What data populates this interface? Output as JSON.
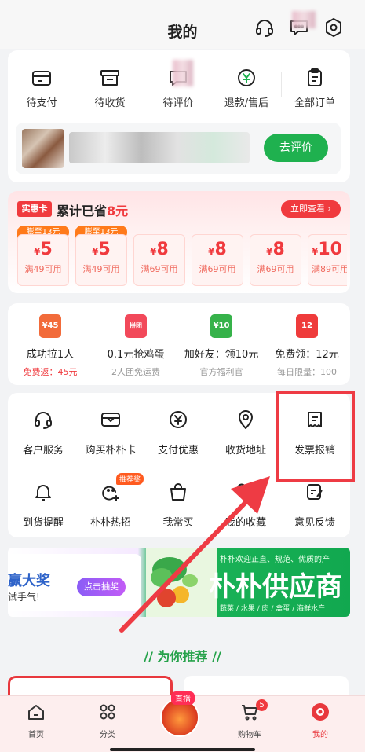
{
  "header": {
    "title": "我的",
    "icons": [
      "headset-icon",
      "message-icon",
      "settings-icon"
    ]
  },
  "orders": {
    "items": [
      {
        "label": "待支付",
        "icon": "wallet-icon"
      },
      {
        "label": "待收货",
        "icon": "box-icon"
      },
      {
        "label": "待评价",
        "icon": "chat-icon"
      },
      {
        "label": "退款/售后",
        "icon": "refund-icon"
      },
      {
        "label": "全部订单",
        "icon": "clipboard-icon"
      }
    ],
    "review_button": "去评价"
  },
  "savings": {
    "badge": "实惠卡",
    "title_prefix": "累计已省",
    "amount": "8元",
    "view_button": "立即查看",
    "coupons": [
      {
        "tag": "膨至13元",
        "value": "5",
        "condition": "满49可用"
      },
      {
        "tag": "膨至13元",
        "value": "5",
        "condition": "满49可用"
      },
      {
        "tag": "",
        "value": "8",
        "condition": "满69可用"
      },
      {
        "tag": "",
        "value": "8",
        "condition": "满69可用"
      },
      {
        "tag": "",
        "value": "8",
        "condition": "满69可用"
      },
      {
        "tag": "",
        "value": "10",
        "condition": "满89可用"
      }
    ],
    "currency": "¥"
  },
  "activities": [
    {
      "title": "成功拉1人",
      "sub": "免费返：45元",
      "icon_text": "¥45",
      "color": "#f26b3a"
    },
    {
      "title": "0.1元抢鸡蛋",
      "sub": "2人团免运费",
      "icon_text": "拼团",
      "color": "#f2495a"
    },
    {
      "title": "加好友：领10元",
      "sub": "官方福利官",
      "icon_text": "¥10",
      "color": "#36b24a"
    },
    {
      "title": "免费领：12元",
      "sub": "每日限量：100",
      "icon_text": "12",
      "color": "#ef3b3b"
    }
  ],
  "services": [
    {
      "label": "客户服务",
      "icon": "headset-icon"
    },
    {
      "label": "购买朴朴卡",
      "icon": "card-icon"
    },
    {
      "label": "支付优惠",
      "icon": "yuan-coin-icon"
    },
    {
      "label": "收货地址",
      "icon": "location-icon"
    },
    {
      "label": "发票报销",
      "icon": "invoice-icon"
    },
    {
      "label": "到货提醒",
      "icon": "bell-icon"
    },
    {
      "label": "朴朴热招",
      "icon": "add-user-icon",
      "tag": "推荐奖"
    },
    {
      "label": "我常买",
      "icon": "shopping-bag-icon"
    },
    {
      "label": "我的收藏",
      "icon": "favorite-icon"
    },
    {
      "label": "意见反馈",
      "icon": "feedback-icon"
    }
  ],
  "banner": {
    "lottery_big": "赢大奖",
    "lottery_small": "试手气!",
    "lottery_button": "点击抽奖",
    "supply_top": "朴朴欢迎正直、规范、优质的产",
    "supply_title": "朴朴供应商",
    "supply_bottom": "蔬菜 / 水果 / 肉 / 禽蛋 / 海鲜水产"
  },
  "recommend": {
    "title": "为你推荐"
  },
  "tabbar": {
    "tabs": [
      {
        "label": "首页",
        "icon": "home-icon"
      },
      {
        "label": "分类",
        "icon": "category-icon"
      },
      {
        "label": "",
        "icon": "live-icon"
      },
      {
        "label": "购物车",
        "icon": "cart-icon"
      },
      {
        "label": "我的",
        "icon": "profile-icon"
      }
    ],
    "live_tag": "直播",
    "cart_count": "5"
  },
  "colors": {
    "accent_red": "#f03a3e",
    "accent_green": "#1fb14f"
  }
}
